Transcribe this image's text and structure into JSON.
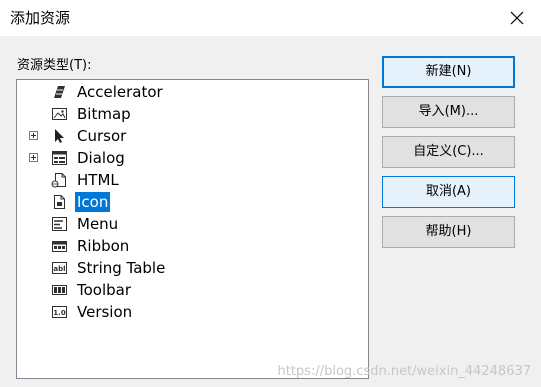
{
  "window": {
    "title": "添加资源",
    "close_glyph": "✕"
  },
  "resource_list": {
    "label": "资源类型(T):",
    "items": [
      {
        "label": "Accelerator",
        "icon": "accelerator-icon",
        "expandable": false,
        "selected": false
      },
      {
        "label": "Bitmap",
        "icon": "bitmap-icon",
        "expandable": false,
        "selected": false
      },
      {
        "label": "Cursor",
        "icon": "cursor-icon",
        "expandable": true,
        "selected": false
      },
      {
        "label": "Dialog",
        "icon": "dialog-icon",
        "expandable": true,
        "selected": false
      },
      {
        "label": "HTML",
        "icon": "html-icon",
        "expandable": false,
        "selected": false
      },
      {
        "label": "Icon",
        "icon": "icon-resource-icon",
        "expandable": false,
        "selected": true
      },
      {
        "label": "Menu",
        "icon": "menu-icon",
        "expandable": false,
        "selected": false
      },
      {
        "label": "Ribbon",
        "icon": "ribbon-icon",
        "expandable": false,
        "selected": false
      },
      {
        "label": "String Table",
        "icon": "string-table-icon",
        "expandable": false,
        "selected": false
      },
      {
        "label": "Toolbar",
        "icon": "toolbar-icon",
        "expandable": false,
        "selected": false
      },
      {
        "label": "Version",
        "icon": "version-icon",
        "expandable": false,
        "selected": false
      }
    ]
  },
  "buttons": {
    "new": "新建(N)",
    "import": "导入(M)...",
    "custom": "自定义(C)...",
    "cancel": "取消(A)",
    "help": "帮助(H)"
  },
  "watermark": "https://blog.csdn.net/weixin_44248637",
  "colors": {
    "selection": "#0078d7",
    "panel": "#f0f0f0",
    "button_face": "#e1e1e1"
  }
}
